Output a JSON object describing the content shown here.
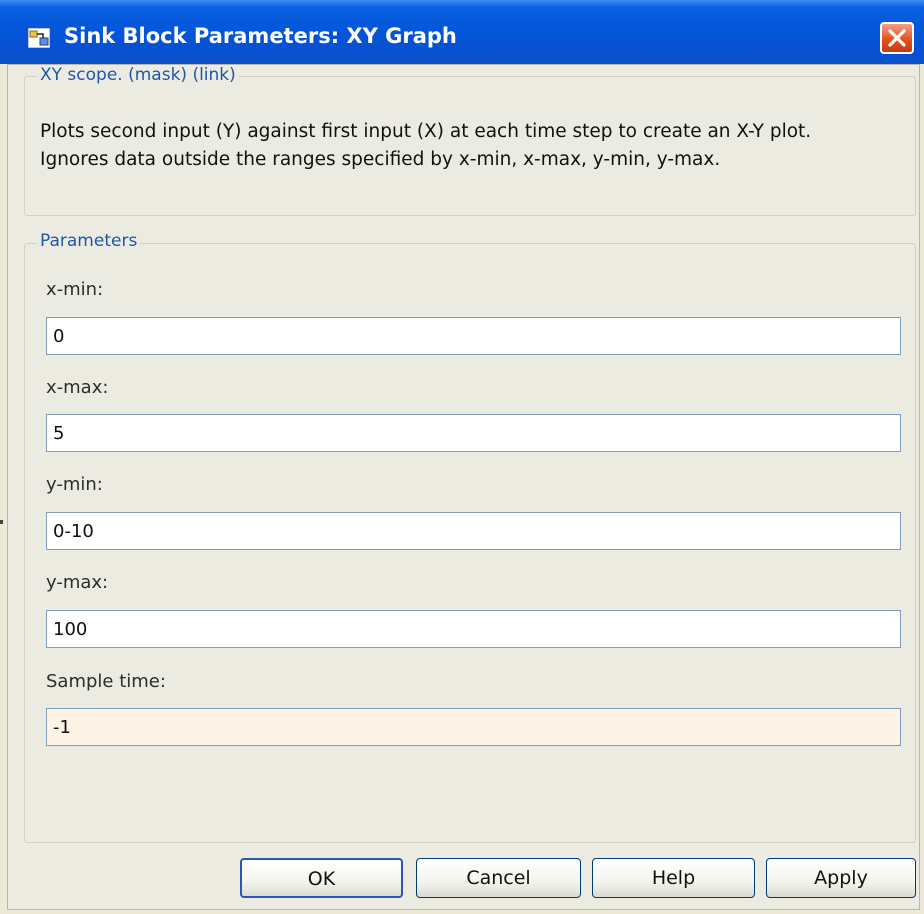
{
  "window": {
    "title": "Sink Block Parameters: XY Graph"
  },
  "description_group": {
    "legend": "XY scope. (mask) (link)",
    "text": "Plots second input (Y) against first input (X) at each time step to create an X-Y plot. Ignores data outside the ranges specified by x-min, x-max, y-min, y-max."
  },
  "parameters": {
    "legend": "Parameters",
    "fields": [
      {
        "label": "x-min:",
        "value": "0"
      },
      {
        "label": "x-max:",
        "value": "5"
      },
      {
        "label": "y-min:",
        "value": "0-10"
      },
      {
        "label": "y-max:",
        "value": "100"
      },
      {
        "label": "Sample time:",
        "value": "-1"
      }
    ]
  },
  "buttons": {
    "ok": "OK",
    "cancel": "Cancel",
    "help": "Help",
    "apply": "Apply"
  },
  "colors": {
    "title_bar": "#0454d8",
    "legend_text": "#1f57a8",
    "close_button": "#e2541f",
    "sample_time_field": "#fdf3e6"
  },
  "icons": [
    "simulink-block-icon",
    "close-icon"
  ]
}
